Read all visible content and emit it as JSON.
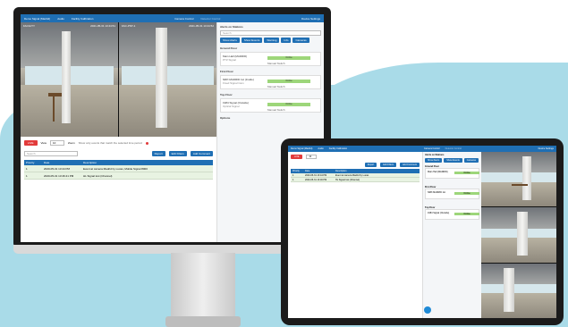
{
  "monitor": {
    "topbar": {
      "left_items": [
        "Demo Signal (Madrid)",
        "Audio",
        "Facility Calibration"
      ],
      "center_label": "Camera Control",
      "center_label_dim": "Detector Control",
      "user": "Device Settings"
    },
    "video_left_label": "FACILITY",
    "video_left_time": "2021-05-31 13:44:51",
    "video_right_label": "FAC-PNT-1",
    "video_right_time": "2021-05-31 13:44:52",
    "controls": {
      "live_label": "LIVE",
      "view_label": "View",
      "view_value": "10",
      "zoom_label": "Zoom",
      "filter_text": "Show only events that match the selected time period",
      "filter_placeholder": "Search",
      "btn_report": "Report",
      "btn_edit": "Edit Filters",
      "btn_add": "Add Comment",
      "toggle_label": "Follow live"
    },
    "table": {
      "headers": [
        "Priority",
        "Date",
        "Description"
      ],
      "rows": [
        [
          "1",
          "2020-05-31 13:44 PM",
          "Event at camera Madrid by Lucas, Mobile Signal 8000"
        ],
        [
          "1",
          "2020-05-31 13:46:41 PM",
          "HL Signal lost (Channel)"
        ]
      ]
    },
    "right_panel": {
      "section1_title": "Alerts on Stations",
      "search_placeholder": "Search",
      "filter_buttons": [
        "Show Alerts",
        "Show Events",
        "Warning",
        "Info",
        "Cameras"
      ],
      "section2_title": "Ground Floor",
      "card1_name": "Main Hall (MADRID)",
      "card1_sub": "PTZ Signal",
      "card1_status": "Online",
      "card1_foot": "Manual Switch",
      "section3_title": "First Floor",
      "card2_name": "NRP-MADRID 1st (Inside)",
      "card2_sub": "Fixed Signal Cam",
      "card2_status": "Online",
      "card2_foot": "Manual Switch",
      "section4_title": "Top Floor",
      "card3_name": "1984 Signal (Outside)",
      "card3_sub": "Optical Signal",
      "card3_status": "Online",
      "card3_foot": "Manual Switch",
      "section5_title": "Options"
    }
  },
  "tablet": {
    "topbar": {
      "items": [
        "Demo Signal (Madrid)",
        "Audio",
        "Facility Calibration"
      ],
      "center": "Camera Control",
      "center_dim": "Detector Control",
      "user": "Device Settings"
    },
    "controls": {
      "live_label": "LIVE",
      "view_value": "10",
      "btn_report": "Report",
      "btn_edit": "Edit Filters",
      "btn_add": "Add Comment"
    },
    "table": {
      "headers": [
        "Priority",
        "Date",
        "Description"
      ],
      "rows": [
        [
          "1",
          "2020-05-31 13:44 PM",
          "Event at camera Madrid by Lucas"
        ],
        [
          "1",
          "2020-05-31 13:46 PM",
          "HL Signal lost (Channel)"
        ]
      ]
    },
    "mid_panel": {
      "title": "Alerts on Stations",
      "buttons": [
        "Show Alerts",
        "Show Events",
        "Cameras"
      ],
      "sec1": "Ground Floor",
      "card1": "Main Hall (MADRID)",
      "sec2": "First Floor",
      "card2": "NRP-MADRID 1st",
      "sec3": "Top Floor",
      "card3": "1984 Signal (Outside)",
      "status": "Online"
    }
  },
  "colors": {
    "accent": "#1f6fb4",
    "live": "#e23b3b",
    "ok": "#9dd67a",
    "background_shape": "#a9dbe8"
  }
}
